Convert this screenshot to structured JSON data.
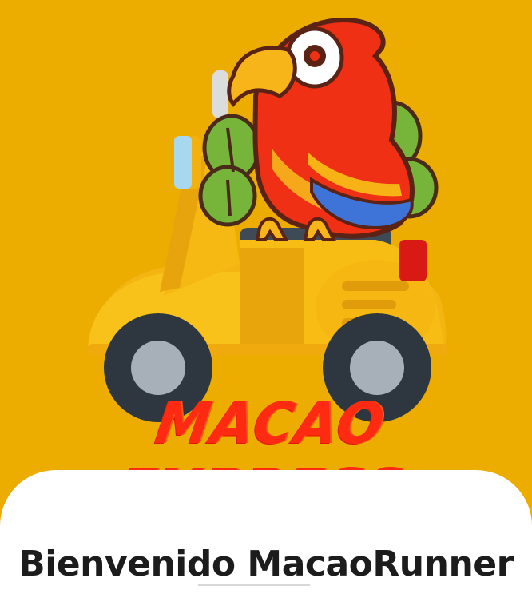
{
  "brand": {
    "name": "MACAO EXPRESS",
    "logo_icon": "parrot-on-scooter-icon"
  },
  "welcome": {
    "title": "Bienvenido MacaoRunner"
  },
  "colors": {
    "background": "#ecad00",
    "brand_red": "#ff2a12",
    "sheet": "#ffffff",
    "text": "#1c1c1c"
  }
}
